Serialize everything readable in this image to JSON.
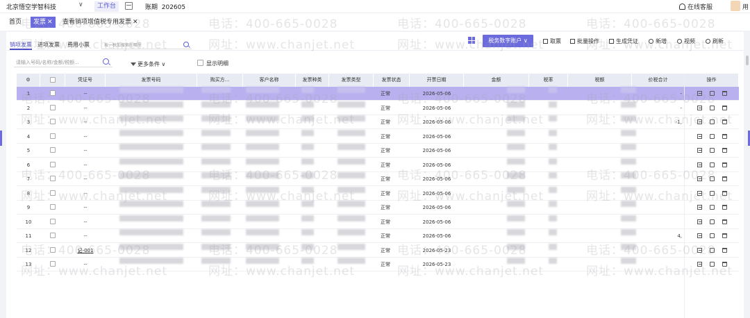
{
  "topbar": {
    "company": "北京悟空学智科技",
    "workbench": "工作台",
    "period_label": "账期",
    "period_value": "202605",
    "online_service": "在线客服",
    "user_fragment": "用"
  },
  "tabs": [
    {
      "label": "首页",
      "active": false
    },
    {
      "label": "发票",
      "active": true,
      "closable": true
    },
    {
      "label": "查看销项增值税专用发票",
      "active": false,
      "closable": true
    }
  ],
  "subtabs": [
    {
      "label": "销项发票",
      "active": true
    },
    {
      "label": "进项发票",
      "active": false
    },
    {
      "label": "费用小票",
      "active": false
    }
  ],
  "subtab_search": {
    "placeholder": "按一税加搜索在哪里"
  },
  "toolbar": {
    "tax_account": "税务数字账户 ∨",
    "fetch": "取票",
    "batch": "批量操作",
    "gen_voucher": "生成凭证",
    "add": "新增",
    "video": "视频",
    "refresh": "刷新"
  },
  "filter": {
    "placeholder": "请输入号码/名称/金额/税额...",
    "more_conditions": "更多条件",
    "show_detail": "显示明细"
  },
  "columns": [
    "凭证号",
    "发票号码",
    "购买方...",
    "客户名称",
    "发票种类",
    "发票类型",
    "发票状态",
    "开票日期",
    "金额",
    "税率",
    "税额",
    "价税合计",
    "操作"
  ],
  "rows": [
    {
      "no": "1",
      "voucher": "--",
      "status": "正常",
      "date": "2026-05-06",
      "total": "-",
      "selected": true
    },
    {
      "no": "2",
      "voucher": "--",
      "status": "正常",
      "date": "2026-05-06",
      "total": "-",
      "selected": false
    },
    {
      "no": "3",
      "voucher": "--",
      "status": "正常",
      "date": "2026-05-06",
      "total": "-1,",
      "selected": false
    },
    {
      "no": "4",
      "voucher": "--",
      "status": "正常",
      "date": "2026-05-06",
      "total": "",
      "selected": false
    },
    {
      "no": "5",
      "voucher": "--",
      "status": "正常",
      "date": "2026-05-06",
      "total": "",
      "selected": false
    },
    {
      "no": "6",
      "voucher": "--",
      "status": "正常",
      "date": "2026-05-06",
      "total": "",
      "selected": false
    },
    {
      "no": "7",
      "voucher": "--",
      "status": "正常",
      "date": "2026-05-06",
      "total": "",
      "selected": false
    },
    {
      "no": "8",
      "voucher": "--",
      "status": "正常",
      "date": "2026-05-06",
      "total": "",
      "selected": false
    },
    {
      "no": "9",
      "voucher": "--",
      "status": "正常",
      "date": "2026-05-06",
      "total": "",
      "selected": false
    },
    {
      "no": "10",
      "voucher": "--",
      "status": "正常",
      "date": "2026-05-06",
      "total": "",
      "selected": false
    },
    {
      "no": "11",
      "voucher": "--",
      "status": "正常",
      "date": "2026-05-06",
      "total": "4,",
      "selected": false
    },
    {
      "no": "12",
      "voucher": "记-001",
      "status": "正常",
      "date": "2026-05-23",
      "total": "",
      "selected": false
    },
    {
      "no": "13",
      "voucher": "--",
      "status": "正常",
      "date": "2026-05-23",
      "total": "",
      "selected": false
    }
  ],
  "watermark": {
    "phone": "电话：400-665-0028",
    "site": "网址：www.chanjet.net"
  },
  "colors": {
    "accent": "#6b6bde",
    "selected_row": "#b9b0f0",
    "header_bg": "#e9ebf4"
  }
}
